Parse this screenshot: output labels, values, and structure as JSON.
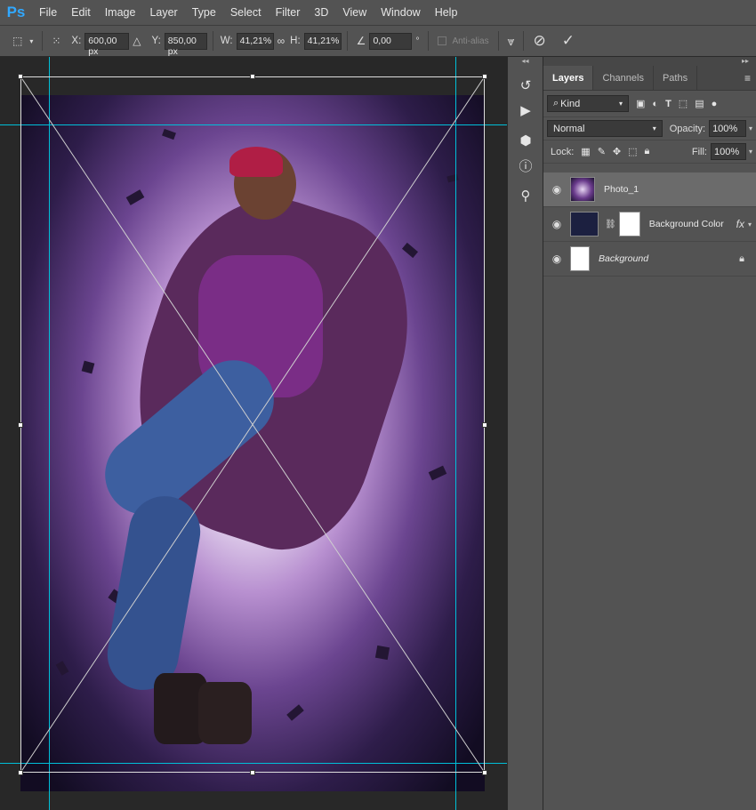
{
  "app": {
    "logo": "Ps"
  },
  "menu": [
    "File",
    "Edit",
    "Image",
    "Layer",
    "Type",
    "Select",
    "Filter",
    "3D",
    "View",
    "Window",
    "Help"
  ],
  "options": {
    "x_label": "X:",
    "x_value": "600,00 px",
    "y_label": "Y:",
    "y_value": "850,00 px",
    "w_label": "W:",
    "w_value": "41,21%",
    "h_label": "H:",
    "h_value": "41,21%",
    "angle_value": "0,00",
    "degree": "°",
    "antialias_label": "Anti-alias",
    "cancel_icon": "⊘",
    "commit_icon": "✓"
  },
  "panel": {
    "tabs": [
      "Layers",
      "Channels",
      "Paths"
    ],
    "filter_kind": "Kind",
    "blend_mode": "Normal",
    "opacity_label": "Opacity:",
    "opacity_value": "100%",
    "lock_label": "Lock:",
    "fill_label": "Fill:",
    "fill_value": "100%",
    "layers": [
      {
        "name": "Photo_1",
        "selected": true
      },
      {
        "name": "Background Color",
        "fx": "fx"
      },
      {
        "name": "Background",
        "locked": true
      }
    ]
  },
  "colors": {
    "accent": "#31a8ff",
    "guide": "#00bfd8",
    "panel": "#535353",
    "canvas_bg": "#282828"
  }
}
